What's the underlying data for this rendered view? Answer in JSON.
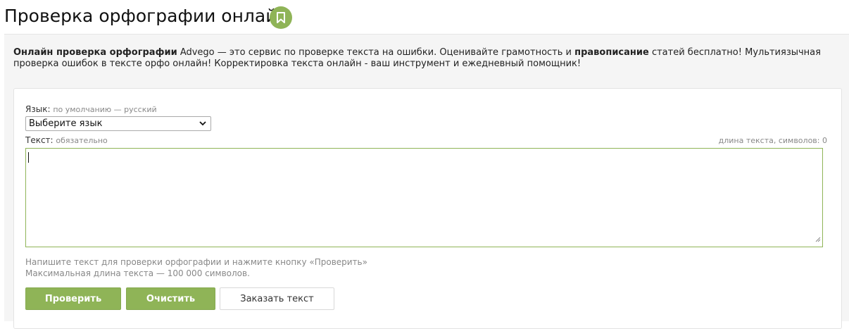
{
  "header": {
    "title": "Проверка орфографии онлайн",
    "bookmark_icon": "bookmark-icon",
    "accent_color": "#8fb457"
  },
  "intro": {
    "bold1": "Онлайн проверка орфографии",
    "text1": " Advego — это сервис по проверке текста на ошибки. Оценивайте грамотность и ",
    "bold2": "правописание",
    "text2": " статей бесплатно! Мультиязычная проверка ошибок в тексте орфо онлайн! Корректировка текста онлайн - ваш инструмент и ежедневный помощник!"
  },
  "form": {
    "language": {
      "label": "Язык:",
      "hint": "по умолчанию — русский",
      "selected": "Выберите язык"
    },
    "text": {
      "label": "Текст:",
      "hint": "обязательно",
      "length_label": "длина текста, символов: 0",
      "value": ""
    },
    "helper_line1": "Напишите текст для проверки орфографии и нажмите кнопку «Проверить»",
    "helper_line2": "Максимальная длина текста — 100 000 символов.",
    "buttons": {
      "check": "Проверить",
      "clear": "Очистить",
      "order": "Заказать текст"
    }
  }
}
